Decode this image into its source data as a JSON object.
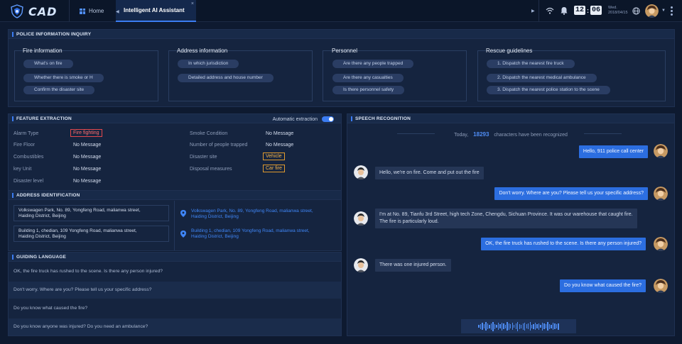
{
  "header": {
    "logo_text": "CAD",
    "home_tab": "Home",
    "active_tab": "Intelligent AI Assistant",
    "close_glyph": "×",
    "clock": {
      "hour": "12",
      "minute": "06"
    },
    "date": {
      "weekday": "Wed.",
      "date": "2018/04/15"
    }
  },
  "inquiry": {
    "title": "POLICE INFORMATION INQUIRY",
    "groups": [
      {
        "title": "Fire information",
        "items": [
          "What's on fire",
          "Whether there is smoke or H",
          "Confirm the disaster site"
        ]
      },
      {
        "title": "Address information",
        "items": [
          "In which jurisdiction",
          "Detailed address and house number"
        ]
      },
      {
        "title": "Personnel",
        "items": [
          "Are there any people trapped",
          "Are there any casualties",
          "Is there personnel safety"
        ]
      },
      {
        "title": "Rescue guidelines",
        "items": [
          "1. Dispatch the nearest fire truck",
          "2. Dispatch the nearest medical ambulance",
          "3. Dispatch the nearest police station to the scene"
        ]
      }
    ]
  },
  "feature": {
    "title": "FEATURE EXTRACTION",
    "auto_label": "Automatic extraction",
    "auto_on": true,
    "left": [
      {
        "label": "Alarm Type",
        "value": "Fire fighting"
      },
      {
        "label": "Fire Floor",
        "value": "No Message"
      },
      {
        "label": "Combustibles",
        "value": "No Message"
      },
      {
        "label": "key Unit",
        "value": "No Message"
      },
      {
        "label": "Disaster level",
        "value": "No Message"
      }
    ],
    "right": [
      {
        "label": "Smoke Condition",
        "value": "No Message"
      },
      {
        "label": "Number of people trapped",
        "value": "No Message"
      },
      {
        "label": "Disaster site",
        "value": "Vehicle"
      },
      {
        "label": "Disposal measures",
        "value": "Car fire"
      }
    ]
  },
  "address": {
    "title": "ADDRESS IDENTIFICATION",
    "entries": [
      {
        "text_1": "Volkswagen Park, No. 89, Yongfeng Road, malianwa street,",
        "text_2": "Haiding District, Beijing",
        "link_1": "Volkswagen Park, No. 89, Yongfeng Road, malianwa street,",
        "link_2": "Haiding District, Beijing"
      },
      {
        "text_1": "Building 1, chedian, 109 Yongfeng Road, malianwa street,",
        "text_2": "Haiding District, Beijing",
        "link_1": "Building 1, chedian, 109 Yongfeng Road, malianwa street,",
        "link_2": "Haiding District, Beijing"
      }
    ]
  },
  "guide": {
    "title": "GUIDING LANGUAGE",
    "items": [
      "OK, the fire truck has rushed to the scene. Is there any person injured?",
      "Don't worry. Where are you? Please tell us your specific address?",
      "Do you know what caused the fire?",
      "Do you know anyone was injured? Do you need an ambulance?"
    ]
  },
  "speech": {
    "title": "SPEECH RECOGNITION",
    "counter_prefix": "Today,",
    "counter_value": "18293",
    "counter_suffix": "characters have been recognized",
    "messages": [
      {
        "side": "out",
        "text": "Hello, 911 police call center"
      },
      {
        "side": "in",
        "text": "Hello, we're on fire. Come and put out the fire"
      },
      {
        "side": "out",
        "text": "Don't worry. Where are you? Please tell us your specific address?"
      },
      {
        "side": "in",
        "text": "I'm at No. 89, Tianfu 3rd Street, high tech Zone, Chengdu, Sichuan Province. It was our warehouse that caught fire.",
        "text_2": "The fire is particularly loud."
      },
      {
        "side": "out",
        "text": "OK, the fire truck has rushed to the scene. Is there any person injured?"
      },
      {
        "side": "in",
        "text": "There was one injured person."
      },
      {
        "side": "out",
        "text": "Do you know what caused the fire?"
      }
    ]
  },
  "colors": {
    "accent": "#3b7cf2",
    "alarm": "#e2484d",
    "warning": "#e09a2e",
    "panel": "#15243f",
    "background": "#0e1a30"
  },
  "icons": [
    "shield-logo-icon",
    "grid-icon",
    "wifi-icon",
    "bell-icon",
    "globe-icon",
    "location-pin-icon",
    "microphone-wave-icon"
  ]
}
